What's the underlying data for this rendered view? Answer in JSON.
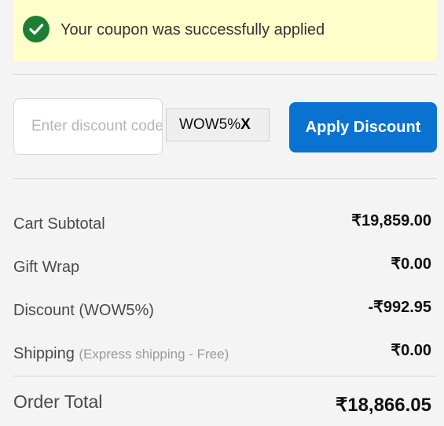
{
  "success_banner": {
    "message": "Your coupon was successfully applied",
    "icon": "check-circle-icon",
    "background": "#ffffcc",
    "icon_color": "#1e7e34"
  },
  "discount_form": {
    "placeholder": "Enter discount code",
    "applied_code": "WOW5%",
    "remove_label": "X",
    "apply_label": "Apply Discount",
    "apply_color": "#0a73d2"
  },
  "summary": {
    "rows": [
      {
        "label": "Cart Subtotal",
        "note": "",
        "value": "₹19,859.00"
      },
      {
        "label": "Gift Wrap",
        "note": "",
        "value": "₹0.00"
      },
      {
        "label": "Discount (WOW5%)",
        "note": "",
        "value": "-₹992.95"
      },
      {
        "label": "Shipping",
        "note": "(Express shipping - Free)",
        "value": "₹0.00"
      }
    ],
    "total_label": "Order Total",
    "total_value": "₹18,866.05"
  }
}
